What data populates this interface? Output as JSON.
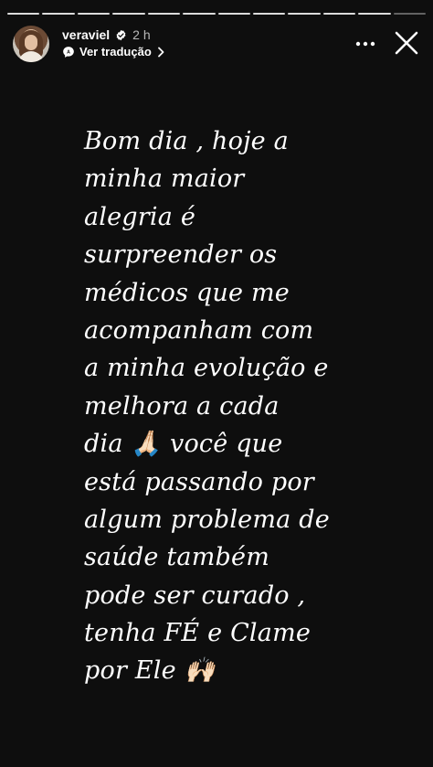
{
  "story": {
    "progress_segments": 12,
    "active_segment": 12,
    "background_color": "#0e0e0e"
  },
  "header": {
    "avatar_icon": "user-avatar",
    "username": "veraviel",
    "verified_icon": "verified-badge-icon",
    "time_ago": "2 h",
    "translate_icon": "translate-icon",
    "translate_label": "Ver tradução",
    "more_icon": "more-dots-icon",
    "close_icon": "close-icon"
  },
  "caption": {
    "lines": [
      "Bom dia , hoje a",
      "minha maior",
      "alegria é",
      "surpreender os",
      "médicos que me",
      "acompanham com",
      "a minha evolução e",
      "melhora a cada",
      "dia 🙏🏻 você que",
      "está passando por",
      "algum problema de",
      "saúde também",
      "pode ser curado ,",
      "tenha FÉ e Clame",
      "por Ele 🙌🏻"
    ]
  }
}
